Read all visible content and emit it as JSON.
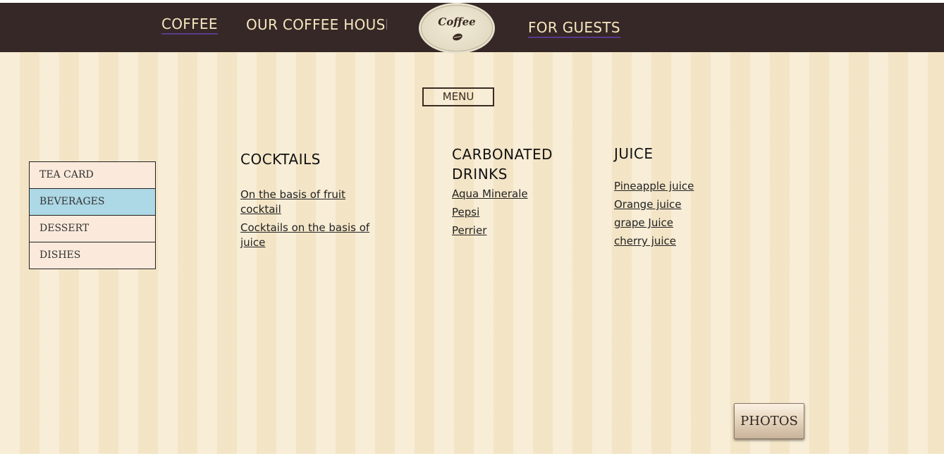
{
  "header": {
    "nav": {
      "coffee": "COFFEE",
      "coffee_house": "OUR COFFEE HOUSE",
      "for_guests": "FOR GUESTS"
    },
    "logo_text": "Coffee"
  },
  "menu_button": "MENU",
  "sidebar": {
    "items": [
      {
        "label": "TEA CARD",
        "active": false
      },
      {
        "label": "BEVERAGES",
        "active": true
      },
      {
        "label": "DESSERT",
        "active": false
      },
      {
        "label": "DISHES",
        "active": false
      }
    ]
  },
  "categories": {
    "cocktails": {
      "title": "COCKTAILS",
      "items": [
        "On the basis of fruit cocktail",
        "Cocktails on the basis of juice"
      ]
    },
    "carbonated": {
      "title": "CARBONATED DRINKS",
      "items": [
        "Aqua Minerale",
        "Pepsi",
        "Perrier"
      ]
    },
    "juice": {
      "title": "JUICE",
      "items": [
        "Pineapple juice",
        "Orange juice",
        "grape Juice",
        "cherry juice"
      ]
    }
  },
  "photos_button": "PHOTOS",
  "colors": {
    "header_bg": "#352827",
    "nav_text": "#f7e6bd",
    "page_bg": "#f6e9cd",
    "sidebar_item_bg": "#fbeadb",
    "sidebar_active_bg": "#add8e6"
  },
  "icons": {
    "logo": "coffee-bean-icon"
  }
}
